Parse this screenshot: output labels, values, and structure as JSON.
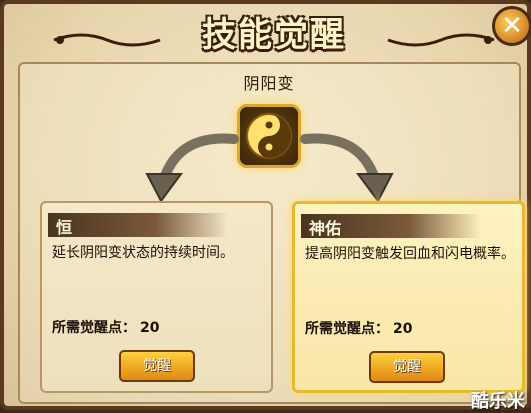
{
  "title": "技能觉醒",
  "close_icon": "close-icon",
  "skill": {
    "name": "阴阳变",
    "icon": "yinyang-icon"
  },
  "cards": [
    {
      "title": "恒",
      "description": "延长阴阳变状态的持续时间。",
      "cost_label": "所需觉醒点：",
      "cost_value": "20",
      "button": "觉醒"
    },
    {
      "title": "神佑",
      "description": "提高阴阳变触发回血和闪电概率。",
      "cost_label": "所需觉醒点：",
      "cost_value": "20",
      "button": "觉醒"
    }
  ],
  "watermark": "酷乐米",
  "colors": {
    "panel": "#e8d6ae",
    "accent_gold": "#e8b830",
    "frame_brown": "#5a3a1e"
  }
}
